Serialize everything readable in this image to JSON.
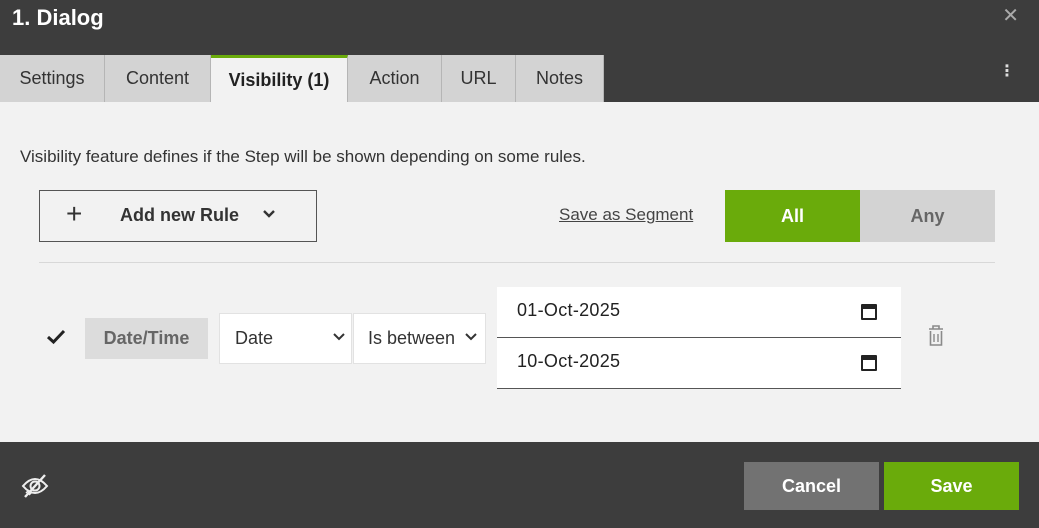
{
  "dialog": {
    "title": "1. Dialog",
    "close_icon": "close-icon",
    "more_icon": "more-vertical-icon"
  },
  "tabs": [
    {
      "label": "Settings",
      "active": false
    },
    {
      "label": "Content",
      "active": false
    },
    {
      "label": "Visibility (1)",
      "active": true
    },
    {
      "label": "Action",
      "active": false
    },
    {
      "label": "URL",
      "active": false
    },
    {
      "label": "Notes",
      "active": false
    }
  ],
  "visibility": {
    "description": "Visibility feature defines if the Step will be shown depending on some rules.",
    "add_rule_label": "Add new Rule",
    "save_segment_label": "Save as Segment",
    "match_toggle": {
      "all_label": "All",
      "any_label": "Any",
      "selected": "All"
    }
  },
  "rule": {
    "enabled_icon": "checkmark-icon",
    "category": "Date/Time",
    "field_select": {
      "value": "Date"
    },
    "operator_select": {
      "value": "Is between"
    },
    "start_date": "01-Oct-2025",
    "end_date": "10-Oct-2025",
    "delete_icon": "trash-icon"
  },
  "footer": {
    "visibility_icon": "eye-off-icon",
    "cancel_label": "Cancel",
    "save_label": "Save"
  },
  "colors": {
    "accent": "#6aab0b",
    "header_bg": "#3d3d3d",
    "content_bg": "#f2f2f2",
    "inactive_tab": "#d3d3d3",
    "cancel_bg": "#727272"
  }
}
